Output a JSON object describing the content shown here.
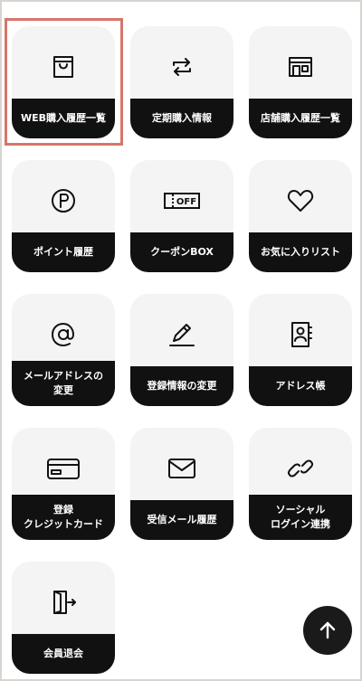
{
  "menu": {
    "items": [
      {
        "label": "WEB購入履歴一覧",
        "icon": "shopping-bag-icon"
      },
      {
        "label": "定期購入情報",
        "icon": "repeat-icon"
      },
      {
        "label": "店舗購入履歴一覧",
        "icon": "store-icon"
      },
      {
        "label": "ポイント履歴",
        "icon": "point-icon"
      },
      {
        "label": "クーポンBOX",
        "icon": "coupon-icon",
        "icon_text": "OFF"
      },
      {
        "label": "お気に入りリスト",
        "icon": "heart-icon"
      },
      {
        "label": "メールアドレスの\n変更",
        "icon": "at-icon"
      },
      {
        "label": "登録情報の変更",
        "icon": "pencil-icon"
      },
      {
        "label": "アドレス帳",
        "icon": "address-book-icon"
      },
      {
        "label": "登録\nクレジットカード",
        "icon": "credit-card-icon"
      },
      {
        "label": "受信メール履歴",
        "icon": "envelope-icon"
      },
      {
        "label": "ソーシャル\nログイン連携",
        "icon": "link-icon"
      },
      {
        "label": "会員退会",
        "icon": "exit-door-icon"
      }
    ],
    "selected_index": 0
  },
  "back_to_top": {
    "icon": "arrow-up-icon"
  },
  "colors": {
    "tile_bg": "#f4f4f4",
    "label_bg": "#111111",
    "highlight": "#d7756a",
    "frame": "#d9d4cf"
  }
}
